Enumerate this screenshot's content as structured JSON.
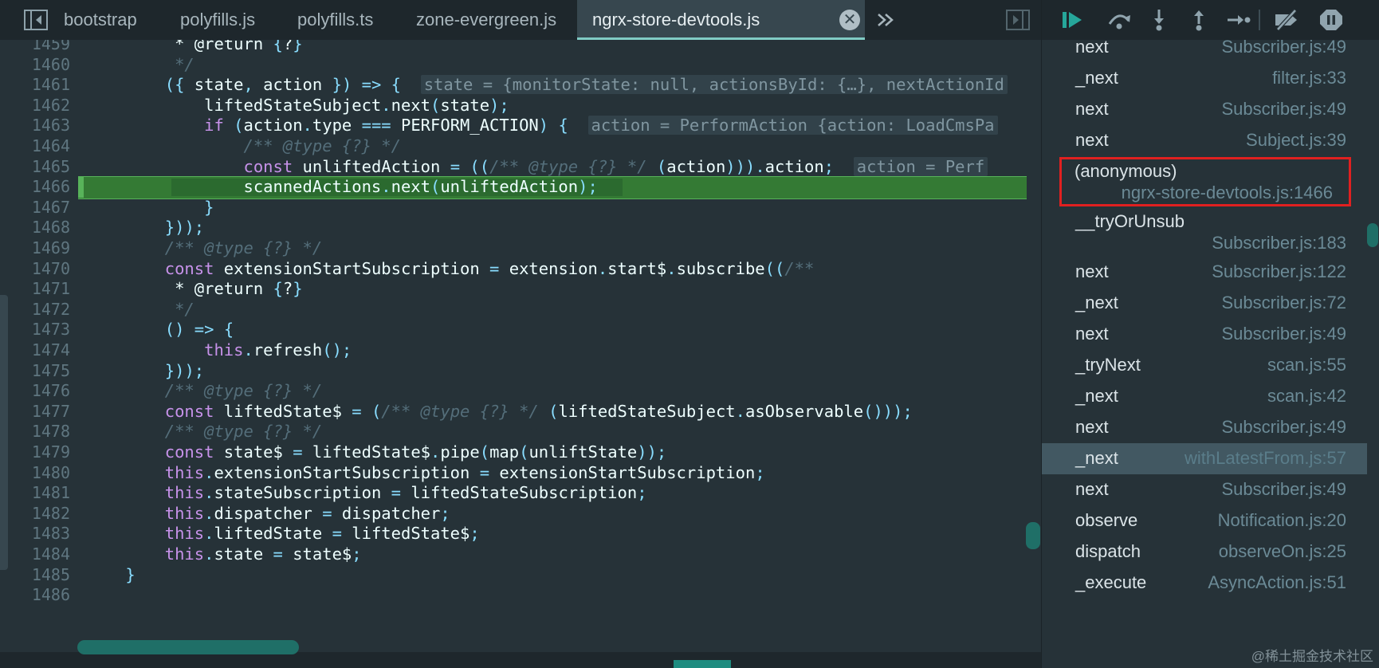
{
  "tabs": [
    {
      "label": "bootstrap",
      "active": false
    },
    {
      "label": "polyfills.js",
      "active": false
    },
    {
      "label": "polyfills.ts",
      "active": false
    },
    {
      "label": "zone-evergreen.js",
      "active": false
    },
    {
      "label": "ngrx-store-devtools.js",
      "active": true
    }
  ],
  "tab_close_glyph": "✕",
  "code_lines": [
    {
      "num": "1459",
      "text": "         * @return {?}"
    },
    {
      "num": "1460",
      "text": "         */"
    },
    {
      "num": "1461",
      "text": "        ({ state, action }) => {",
      "hint": "state = {monitorState: null, actionsById: {…}, nextActionId"
    },
    {
      "num": "1462",
      "text": "            liftedStateSubject.next(state);"
    },
    {
      "num": "1463",
      "text": "            if (action.type === PERFORM_ACTION) {",
      "hint": "action = PerformAction {action: LoadCmsPa"
    },
    {
      "num": "1464",
      "text": "                /** @type {?} */"
    },
    {
      "num": "1465",
      "text": "                const unliftedAction = ((/** @type {?} */ (action))).action;",
      "hint": "action = Perf"
    },
    {
      "num": "1466",
      "text": "                scannedActions.next(unliftedAction);"
    },
    {
      "num": "1467",
      "text": "            }"
    },
    {
      "num": "1468",
      "text": "        }));"
    },
    {
      "num": "1469",
      "text": "        /** @type {?} */"
    },
    {
      "num": "1470",
      "text": "        const extensionStartSubscription = extension.start$.subscribe((/**"
    },
    {
      "num": "1471",
      "text": "         * @return {?}"
    },
    {
      "num": "1472",
      "text": "         */"
    },
    {
      "num": "1473",
      "text": "        () => {"
    },
    {
      "num": "1474",
      "text": "            this.refresh();"
    },
    {
      "num": "1475",
      "text": "        }));"
    },
    {
      "num": "1476",
      "text": "        /** @type {?} */"
    },
    {
      "num": "1477",
      "text": "        const liftedState$ = (/** @type {?} */ (liftedStateSubject.asObservable()));"
    },
    {
      "num": "1478",
      "text": "        /** @type {?} */"
    },
    {
      "num": "1479",
      "text": "        const state$ = liftedState$.pipe(map(unliftState));"
    },
    {
      "num": "1480",
      "text": "        this.extensionStartSubscription = extensionStartSubscription;"
    },
    {
      "num": "1481",
      "text": "        this.stateSubscription = liftedStateSubscription;"
    },
    {
      "num": "1482",
      "text": "        this.dispatcher = dispatcher;"
    },
    {
      "num": "1483",
      "text": "        this.liftedState = liftedState$;"
    },
    {
      "num": "1484",
      "text": "        this.state = state$;"
    },
    {
      "num": "1485",
      "text": "    }"
    },
    {
      "num": "1486",
      "text": ""
    }
  ],
  "current_line": "1466",
  "call_stack": [
    {
      "name": "next",
      "location": "Subscriber.js:49"
    },
    {
      "name": "_next",
      "location": "filter.js:33"
    },
    {
      "name": "next",
      "location": "Subscriber.js:49"
    },
    {
      "name": "next",
      "location": "Subject.js:39"
    },
    {
      "name": "(anonymous)",
      "location": "ngrx-store-devtools.js:1466",
      "wrap": true,
      "boxed": true
    },
    {
      "name": "__tryOrUnsub",
      "location": "Subscriber.js:183",
      "wrap": true
    },
    {
      "name": "next",
      "location": "Subscriber.js:122"
    },
    {
      "name": "_next",
      "location": "Subscriber.js:72"
    },
    {
      "name": "next",
      "location": "Subscriber.js:49"
    },
    {
      "name": "_tryNext",
      "location": "scan.js:55"
    },
    {
      "name": "_next",
      "location": "scan.js:42"
    },
    {
      "name": "next",
      "location": "Subscriber.js:49"
    },
    {
      "name": "_next",
      "location": "withLatestFrom.js:57",
      "selected": true
    },
    {
      "name": "next",
      "location": "Subscriber.js:49"
    },
    {
      "name": "observe",
      "location": "Notification.js:20"
    },
    {
      "name": "dispatch",
      "location": "observeOn.js:25"
    },
    {
      "name": "_execute",
      "location": "AsyncAction.js:51"
    }
  ],
  "debugger_buttons": [
    "resume-icon",
    "step-over-icon",
    "step-into-icon",
    "step-out-icon",
    "step-icon",
    "deactivate-breakpoints-icon",
    "pause-on-exceptions-icon"
  ],
  "watermark": "@稀土掘金技术社区",
  "colors": {
    "background": "#263238",
    "tabbar": "#1e272c",
    "current_line": "#347a34",
    "accent": "#80cbc4",
    "frame_box": "#e02020"
  }
}
